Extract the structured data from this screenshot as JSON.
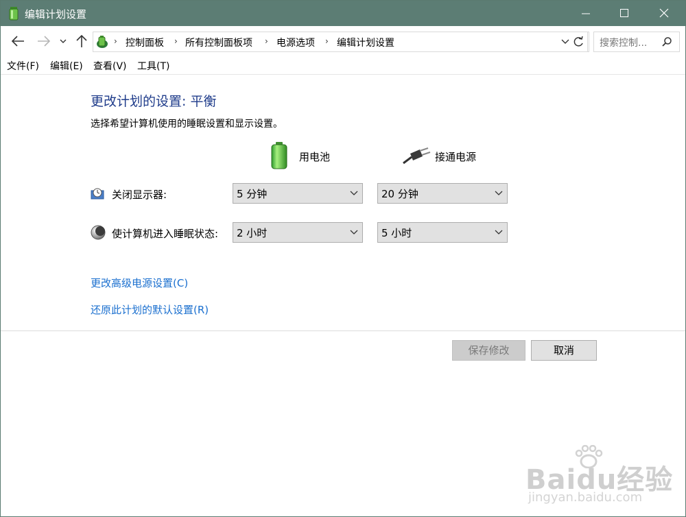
{
  "window": {
    "title": "编辑计划设置"
  },
  "nav": {
    "breadcrumbs": [
      "控制面板",
      "所有控制面板项",
      "电源选项",
      "编辑计划设置"
    ],
    "search_placeholder": "搜索控制..."
  },
  "menu": {
    "items": [
      "文件(F)",
      "编辑(E)",
      "查看(V)",
      "工具(T)"
    ]
  },
  "content": {
    "heading": "更改计划的设置: 平衡",
    "subtext": "选择希望计算机使用的睡眠设置和显示设置。",
    "col_battery": "用电池",
    "col_plugged": "接通电源",
    "rows": [
      {
        "label": "关闭显示器:",
        "battery": "5 分钟",
        "plugged": "20 分钟"
      },
      {
        "label": "使计算机进入睡眠状态:",
        "battery": "2 小时",
        "plugged": "5 小时"
      }
    ],
    "link_advanced": "更改高级电源设置(C)",
    "link_restore": "还原此计划的默认设置(R)"
  },
  "buttons": {
    "save": "保存修改",
    "cancel": "取消"
  },
  "watermark": {
    "brand": "Baidu经验",
    "url": "jingyan.baidu.com"
  },
  "colors": {
    "titlebar": "#5c7d74",
    "heading": "#1e3b8a",
    "link": "#1a6fcf"
  }
}
